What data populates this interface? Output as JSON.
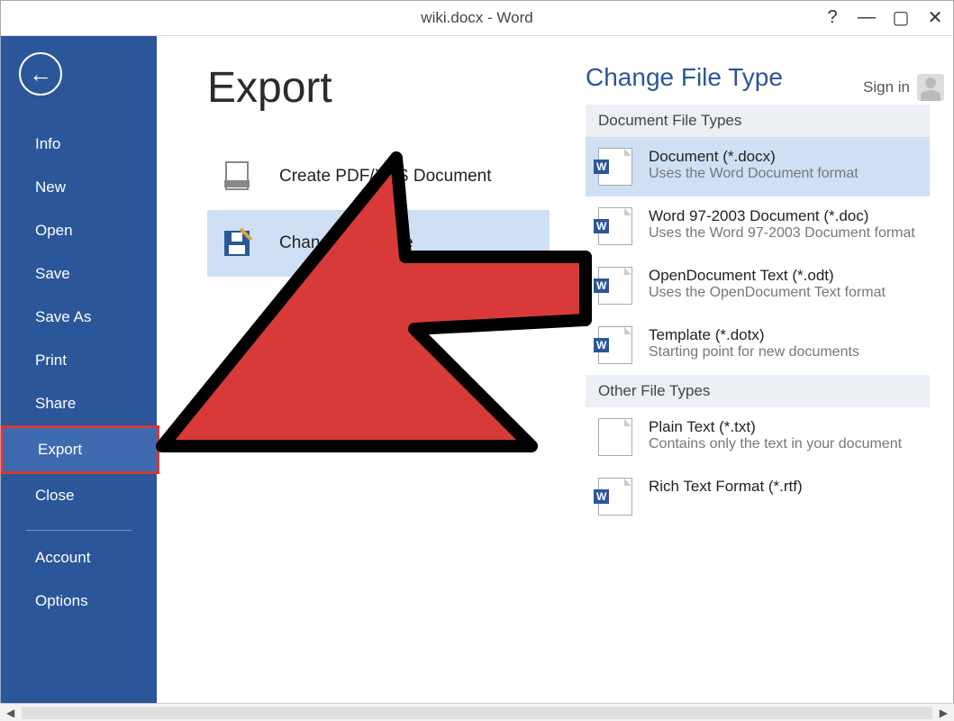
{
  "window": {
    "title": "wiki.docx - Word",
    "help": "?",
    "signin": "Sign in"
  },
  "sidebar": {
    "items": [
      {
        "label": "Info"
      },
      {
        "label": "New"
      },
      {
        "label": "Open"
      },
      {
        "label": "Save"
      },
      {
        "label": "Save As"
      },
      {
        "label": "Print"
      },
      {
        "label": "Share"
      },
      {
        "label": "Export"
      },
      {
        "label": "Close"
      }
    ],
    "footer": [
      {
        "label": "Account"
      },
      {
        "label": "Options"
      }
    ]
  },
  "page": {
    "title": "Export",
    "options": [
      {
        "label": "Create PDF/XPS Document"
      },
      {
        "label": "Change File Type"
      }
    ]
  },
  "panel": {
    "title": "Change File Type",
    "groups": [
      {
        "title": "Document File Types",
        "items": [
          {
            "name": "Document (*.docx)",
            "desc": "Uses the Word Document format"
          },
          {
            "name": "Word 97-2003 Document (*.doc)",
            "desc": "Uses the Word 97-2003 Document format"
          },
          {
            "name": "OpenDocument Text (*.odt)",
            "desc": "Uses the OpenDocument Text format"
          },
          {
            "name": "Template (*.dotx)",
            "desc": "Starting point for new documents"
          }
        ]
      },
      {
        "title": "Other File Types",
        "items": [
          {
            "name": "Plain Text (*.txt)",
            "desc": "Contains only the text in your document"
          },
          {
            "name": "Rich Text Format (*.rtf)",
            "desc": ""
          }
        ]
      }
    ]
  }
}
